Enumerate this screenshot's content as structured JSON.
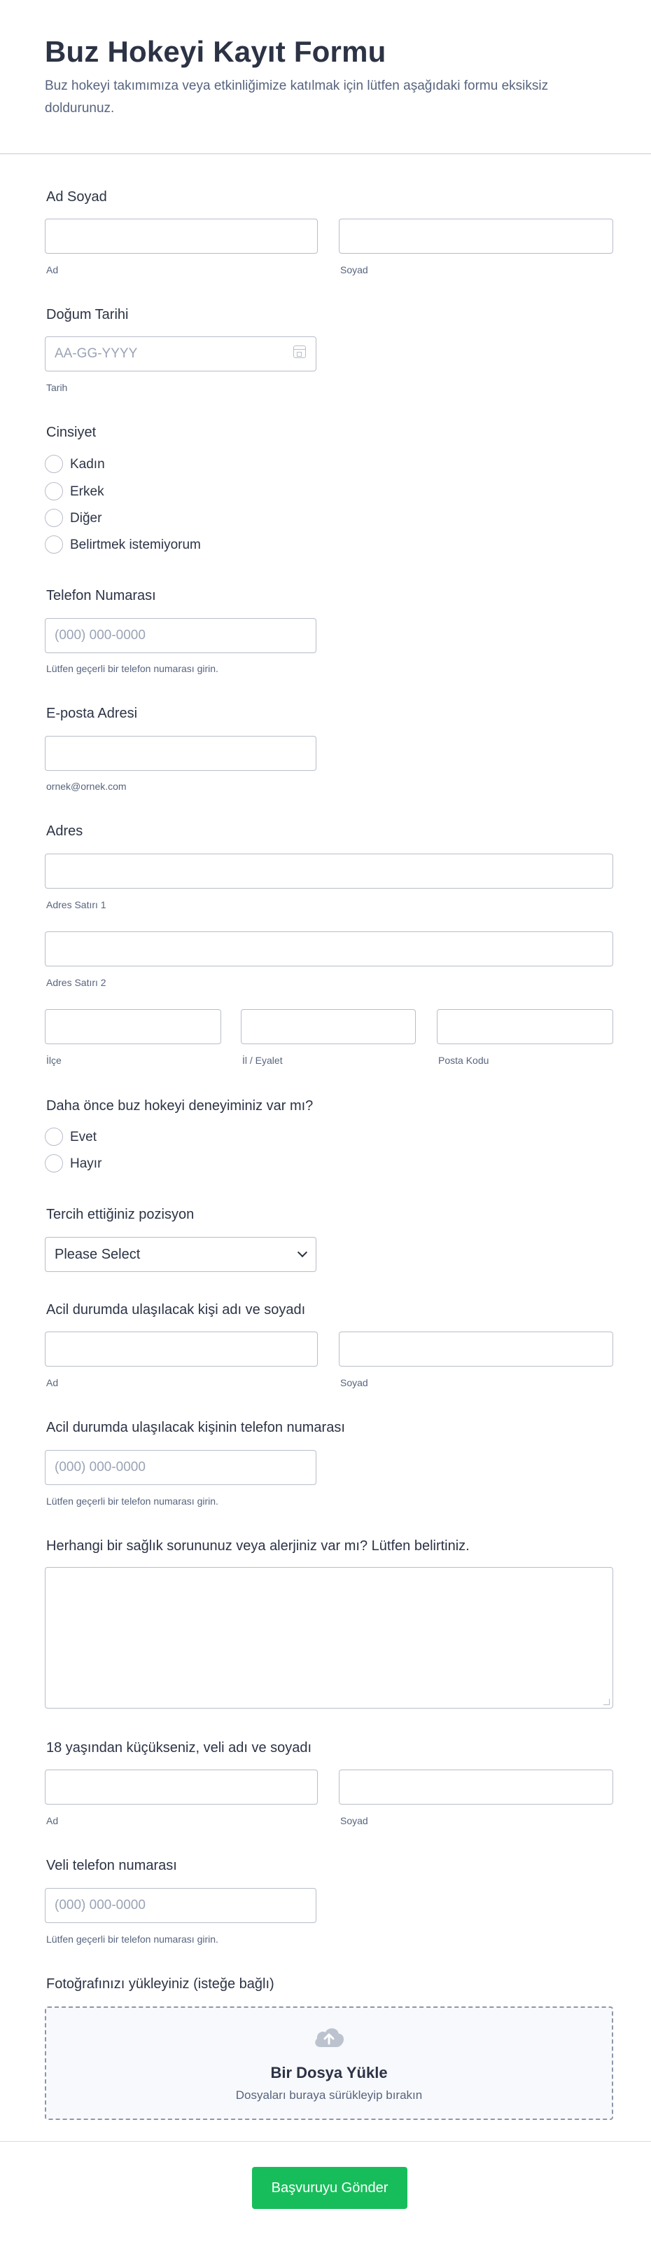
{
  "header": {
    "title": "Buz Hokeyi Kayıt Formu",
    "description": "Buz hokeyi takımımıza veya etkinliğimize katılmak için lütfen aşağıdaki formu eksiksiz doldurunuz."
  },
  "full_name": {
    "label": "Ad Soyad",
    "first_sub": "Ad",
    "last_sub": "Soyad"
  },
  "birth_date": {
    "label": "Doğum Tarihi",
    "placeholder": "AA-GG-YYYY",
    "sub": "Tarih"
  },
  "gender": {
    "label": "Cinsiyet",
    "options": [
      "Kadın",
      "Erkek",
      "Diğer",
      "Belirtmek istemiyorum"
    ]
  },
  "phone": {
    "label": "Telefon Numarası",
    "placeholder": "(000) 000-0000",
    "sub": "Lütfen geçerli bir telefon numarası girin."
  },
  "email": {
    "label": "E-posta Adresi",
    "sub": "ornek@ornek.com"
  },
  "address": {
    "label": "Adres",
    "line1_sub": "Adres Satırı 1",
    "line2_sub": "Adres Satırı 2",
    "district_sub": "İlçe",
    "province_sub": "İl / Eyalet",
    "postal_sub": "Posta Kodu"
  },
  "experience": {
    "label": "Daha önce buz hokeyi deneyiminiz var mı?",
    "options": [
      "Evet",
      "Hayır"
    ]
  },
  "position": {
    "label": "Tercih ettiğiniz pozisyon",
    "selected": "Please Select"
  },
  "emergency_name": {
    "label": "Acil durumda ulaşılacak kişi adı ve soyadı",
    "first_sub": "Ad",
    "last_sub": "Soyad"
  },
  "emergency_phone": {
    "label": "Acil durumda ulaşılacak kişinin telefon numarası",
    "placeholder": "(000) 000-0000",
    "sub": "Lütfen geçerli bir telefon numarası girin."
  },
  "health": {
    "label": "Herhangi bir sağlık sorununuz veya alerjiniz var mı? Lütfen belirtiniz."
  },
  "guardian_name": {
    "label": "18 yaşından küçükseniz, veli adı ve soyadı",
    "first_sub": "Ad",
    "last_sub": "Soyad"
  },
  "guardian_phone": {
    "label": "Veli telefon numarası",
    "placeholder": "(000) 000-0000",
    "sub": "Lütfen geçerli bir telefon numarası girin."
  },
  "photo": {
    "label": "Fotoğrafınızı yükleyiniz (isteğe bağlı)",
    "upload_title": "Bir Dosya Yükle",
    "upload_hint": "Dosyaları buraya sürükleyip bırakın"
  },
  "submit": {
    "label": "Başvuruyu Gönder",
    "color": "#18bd5b"
  },
  "colors": {
    "text": "#2c3345",
    "muted": "#57647e",
    "border": "#b8bdc9"
  }
}
